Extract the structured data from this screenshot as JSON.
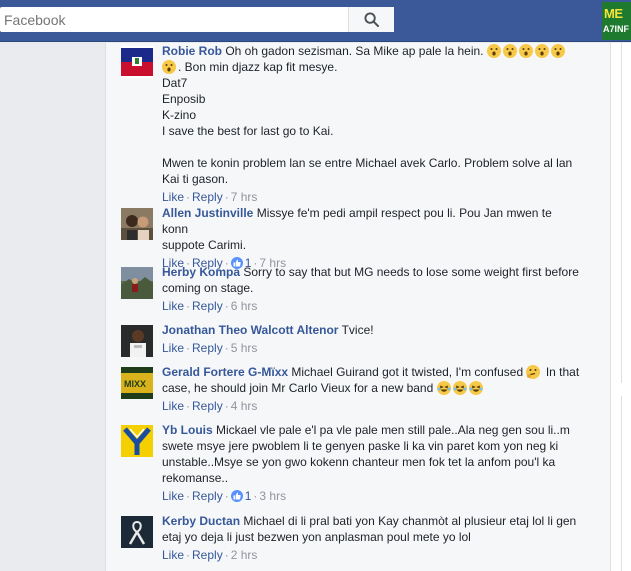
{
  "search": {
    "placeholder": "Facebook"
  },
  "brand": {
    "line1": "ME",
    "line2": "A7INF"
  },
  "comments": [
    {
      "author": "Robie Rob",
      "lines": [
        "Oh oh gadon sezisman. Sa Mike ap pale la hein.",
        ". Bon min djazz kap fit mesye.",
        "Dat7",
        "Enposib",
        "K-zino",
        "I save the best for last go to Kai.",
        "Mwen te konin problem lan se entre Michael avek Carlo. Problem solve al lan",
        "Kai ti gason."
      ],
      "like": "Like",
      "reply": "Reply",
      "time": "7 hrs"
    },
    {
      "author": "Allen Justinville",
      "lines": [
        "Missye fe'm pedi ampil respect pou li. Pou Jan mwen te konn",
        "suppote Carimi."
      ],
      "like": "Like",
      "reply": "Reply",
      "reactions": "1",
      "time": "7 hrs"
    },
    {
      "author": "Herby Kompa",
      "lines": [
        "Sorry to say that but MG needs to lose some weight first before",
        "coming on stage."
      ],
      "like": "Like",
      "reply": "Reply",
      "time": "6 hrs"
    },
    {
      "author": "Jonathan Theo Walcott Altenor",
      "lines": [
        "Tvice!"
      ],
      "like": "Like",
      "reply": "Reply",
      "time": "5 hrs"
    },
    {
      "author": "Gerald Fortere G-Mïxx",
      "lines": [
        "Michael Guirand got it twisted, I'm confused",
        "In that",
        "case, he should join Mr Carlo Vieux for a new band"
      ],
      "like": "Like",
      "reply": "Reply",
      "time": "4 hrs"
    },
    {
      "author": "Yb Louis",
      "lines": [
        "Mickael vle pale e'l pa vle pale men still pale..Ala neg gen sou li..m",
        "swete msye jere pwoblem li te genyen paske li ka vin paret kom yon neg ki",
        "unstable..Msye se yon gwo kokenn chanteur men fok tet la anfom pou'l ka",
        "rekomanse.."
      ],
      "like": "Like",
      "reply": "Reply",
      "reactions": "1",
      "time": "3 hrs"
    },
    {
      "author": "Kerby Ductan",
      "lines": [
        "Michael di li pral bati yon Kay chanmòt al plusieur etaj lol li gen",
        "etaj yo deja li just bezwen yon anplasman poul mete yo lol"
      ],
      "like": "Like",
      "reply": "Reply",
      "time": "2 hrs"
    }
  ],
  "colors": {
    "topbar": "#3b5998",
    "link": "#365899",
    "meta": "#90949c",
    "panel": "#f6f7f9",
    "like_badge": "#5890ff"
  }
}
